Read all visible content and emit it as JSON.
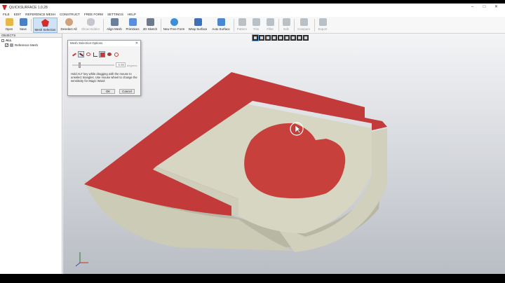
{
  "app": {
    "title": "QUICKSURFACE 1.0.28"
  },
  "window_controls": [
    "–",
    "□",
    "✕"
  ],
  "menu": [
    "FILE",
    "EDIT",
    "REFERENCE MESH",
    "CONSTRUCT",
    "FREE FORM",
    "SETTINGS",
    "HELP"
  ],
  "ribbon": [
    {
      "label": "Open",
      "icon": "folder-icon",
      "color": "#e6b84a",
      "state": "normal"
    },
    {
      "label": "Save",
      "icon": "save-icon",
      "color": "#4a7fc1",
      "state": "normal"
    },
    {
      "label": "Mesh Selection",
      "icon": "mesh-selection-icon",
      "color": "#d62b2b",
      "state": "active"
    },
    {
      "label": "Deselect All",
      "icon": "deselect-icon",
      "color": "#d0a27a",
      "state": "normal"
    },
    {
      "label": "Show Hidden",
      "icon": "eye-icon",
      "color": "#9aa3ad",
      "state": "disabled"
    },
    {
      "label": "Align Mesh",
      "icon": "align-icon",
      "color": "#6a7f99",
      "state": "normal"
    },
    {
      "label": "Primitives",
      "icon": "primitives-icon",
      "color": "#5a8ed6",
      "state": "normal"
    },
    {
      "label": "2D Sketch",
      "icon": "sketch-icon",
      "color": "#6c7a8c",
      "state": "normal"
    },
    {
      "label": "New Free Form",
      "icon": "freeform-icon",
      "color": "#3b8fd6",
      "state": "normal"
    },
    {
      "label": "Wrap Surface",
      "icon": "wrap-icon",
      "color": "#3f6fb8",
      "state": "normal"
    },
    {
      "label": "Auto Surface",
      "icon": "auto-surface-icon",
      "color": "#4b86cf",
      "state": "normal"
    },
    {
      "label": "Pattern",
      "icon": "pattern-icon",
      "color": "#8b939c",
      "state": "disabled"
    },
    {
      "label": "Trim",
      "icon": "trim-icon",
      "color": "#8b939c",
      "state": "disabled"
    },
    {
      "label": "Fillet",
      "icon": "fillet-icon",
      "color": "#8b939c",
      "state": "disabled"
    },
    {
      "label": "Edit",
      "icon": "edit-icon",
      "color": "#8b939c",
      "state": "disabled"
    },
    {
      "label": "Compare",
      "icon": "compare-icon",
      "color": "#8b939c",
      "state": "disabled"
    },
    {
      "label": "Export",
      "icon": "export-icon",
      "color": "#8b939c",
      "state": "disabled"
    }
  ],
  "objects_panel": {
    "header": "OBJECTS",
    "items": [
      {
        "label": "ALL",
        "checked": true
      },
      {
        "label": "Reference Mesh",
        "checked": true
      }
    ]
  },
  "viewport_tools": [
    "view-iso-icon",
    "view-front-icon",
    "view-back-icon",
    "view-left-icon",
    "view-right-icon",
    "view-top-icon",
    "view-bottom-icon",
    "shading-icon",
    "wireframe-icon"
  ],
  "dialog": {
    "title": "Mesh Selection Options",
    "close": "✕",
    "value": "5.96",
    "unit": "degrees",
    "help_text": "Hold ALT key while dragging with the mouse to unselect triangles. Use mouse wheel to change the sensitivity for Magic Wand",
    "ok_label": "OK",
    "cancel_label": "Cancel"
  },
  "colors": {
    "selection": "#c23a39",
    "mesh": "#d4d3c0",
    "mesh_shadow": "#b7b6a2",
    "accent": "#cfe3f7"
  }
}
